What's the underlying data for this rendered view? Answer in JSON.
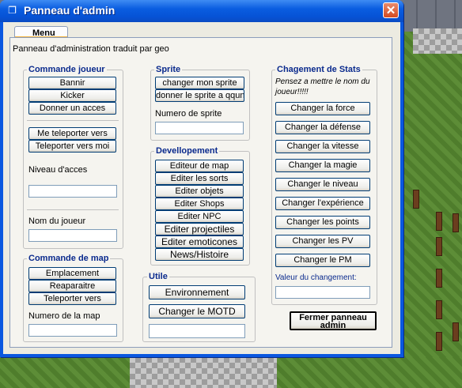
{
  "window": {
    "title": "Panneau d'admin",
    "close_glyph": "✕",
    "icon": "window-icon"
  },
  "tab": {
    "label": "Menu"
  },
  "subtitle": "Panneau d'administration traduit par geo",
  "commande_joueur": {
    "title": "Commande joueur",
    "bannir": "Bannir",
    "kicker": "Kicker",
    "donner_acces": "Donner un acces",
    "me_teleporter": "Me teleporter vers",
    "teleporter_vers_moi": "Teleporter vers moi",
    "niveau_label": "Niveau d'acces",
    "niveau_value": "",
    "nom_label": "Nom du joueur",
    "nom_value": ""
  },
  "commande_map": {
    "title": "Commande de map",
    "emplacement": "Emplacement",
    "reaparaitre": "Reaparaitre",
    "teleporter_vers": "Teleporter vers",
    "numero_label": "Numero de la map",
    "numero_value": ""
  },
  "sprite": {
    "title": "Sprite",
    "changer": "changer mon sprite",
    "donner": "donner le sprite a qqun",
    "numero_label": "Numero de sprite",
    "numero_value": ""
  },
  "developpement": {
    "title": "Devellopement",
    "items": [
      "Editeur de map",
      "Editer les sorts",
      "Editer objets",
      "Editer Shops",
      "Editer NPC",
      "Editer projectiles",
      "Editer emoticones",
      "News/Histoire"
    ]
  },
  "utile": {
    "title": "Utile",
    "environnement": "Environnement",
    "motd": "Changer le MOTD",
    "motd_value": ""
  },
  "stats": {
    "title": "Chagement de Stats",
    "note": "Pensez a mettre le nom du joueur!!!!!",
    "items": [
      "Changer la force",
      "Changer la défense",
      "Changer la vitesse",
      "Changer la magie",
      "Changer le niveau",
      "Changer l'expérience",
      "Changer les points",
      "Changer les PV",
      "Changer le PM"
    ],
    "valeur_label": "Valeur du changement:",
    "valeur_value": ""
  },
  "fermer": "Fermer panneau\nadmin",
  "colors": {
    "title_bar": "#0a5de0",
    "group_title": "#0a2a8d",
    "close": "#d34a21"
  }
}
